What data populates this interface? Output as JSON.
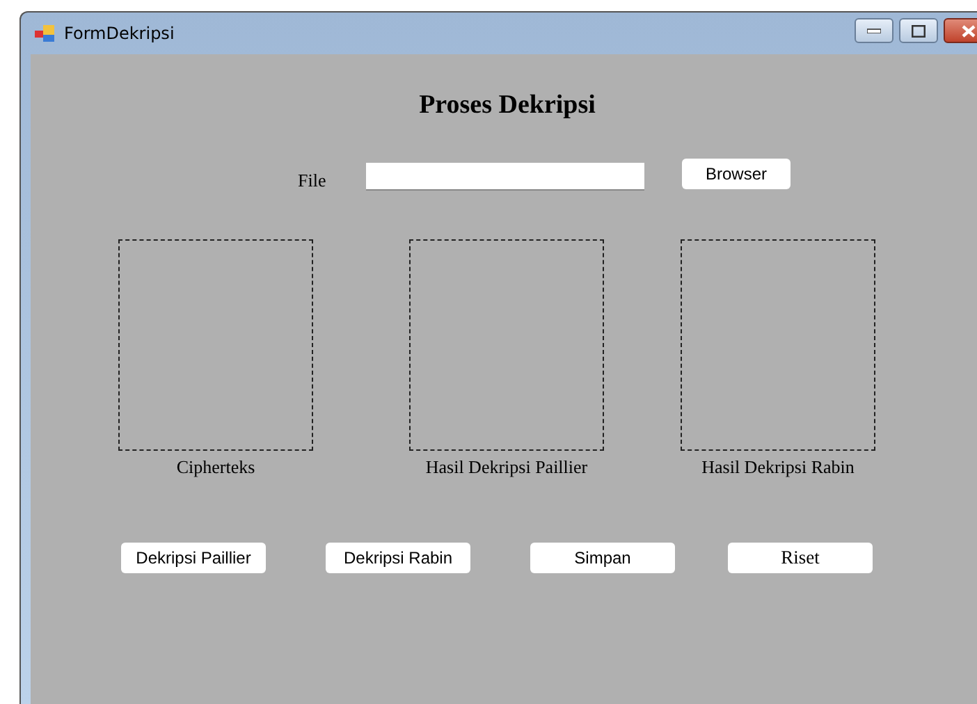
{
  "window": {
    "title": "FormDekripsi"
  },
  "heading": "Proses Dekripsi",
  "file": {
    "label": "File"
  },
  "browse_button": "Browser",
  "panels": [
    {
      "caption": "Cipherteks"
    },
    {
      "caption": "Hasil Dekripsi Paillier"
    },
    {
      "caption": "Hasil Dekripsi Rabin"
    }
  ],
  "buttons": [
    {
      "label": "Dekripsi Paillier",
      "kind": "sans"
    },
    {
      "label": "Dekripsi Rabin",
      "kind": "sans"
    },
    {
      "label": "Simpan",
      "kind": "sans"
    },
    {
      "label": "Riset",
      "kind": "serif"
    }
  ]
}
